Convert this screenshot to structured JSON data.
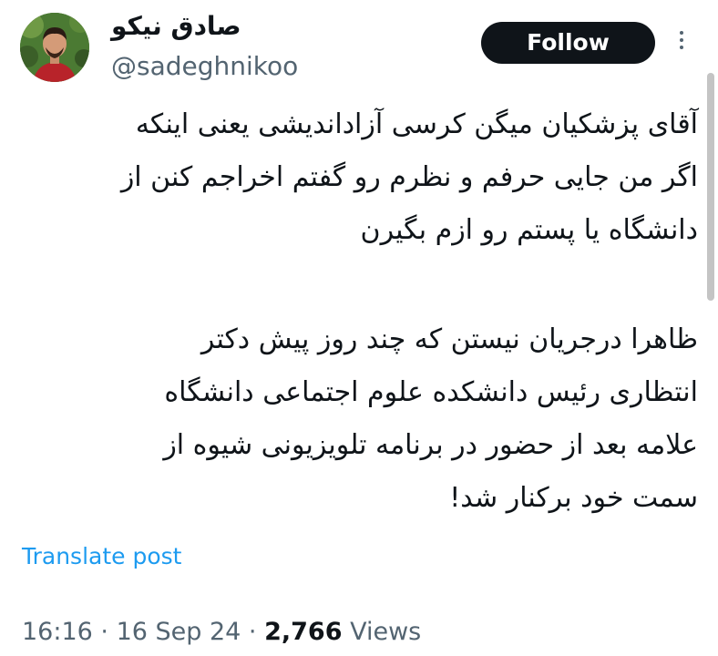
{
  "author": {
    "display_name": "صادق نیکو",
    "handle": "@sadeghnikoo"
  },
  "actions": {
    "follow_label": "Follow",
    "more_icon": "more-horizontal-icon"
  },
  "tweet": {
    "paragraphs": [
      {
        "lines": [
          "آقای پزشکیان میگن کرسی آزاداندیشی یعنی اینکه",
          "اگر من جایی حرفم و نظرم رو گفتم اخراجم کنن از",
          "دانشگاه یا پستم رو ازم بگیرن"
        ]
      },
      {
        "lines": [
          "ظاهرا درجریان نیستن که چند روز پیش دکتر",
          "انتظاری رئیس دانشکده علوم اجتماعی دانشگاه",
          "علامه بعد از حضور در برنامه تلویزیونی شیوه از",
          "سمت خود برکنار شد!"
        ]
      }
    ],
    "translate_label": "Translate post"
  },
  "meta": {
    "time": "16:16",
    "separator": " · ",
    "date": "16 Sep 24",
    "views_count": "2,766",
    "views_label": "Views"
  },
  "colors": {
    "text_primary": "#0f1419",
    "text_secondary": "#536471",
    "link": "#1d9bf0",
    "follow_bg": "#0f1419"
  }
}
